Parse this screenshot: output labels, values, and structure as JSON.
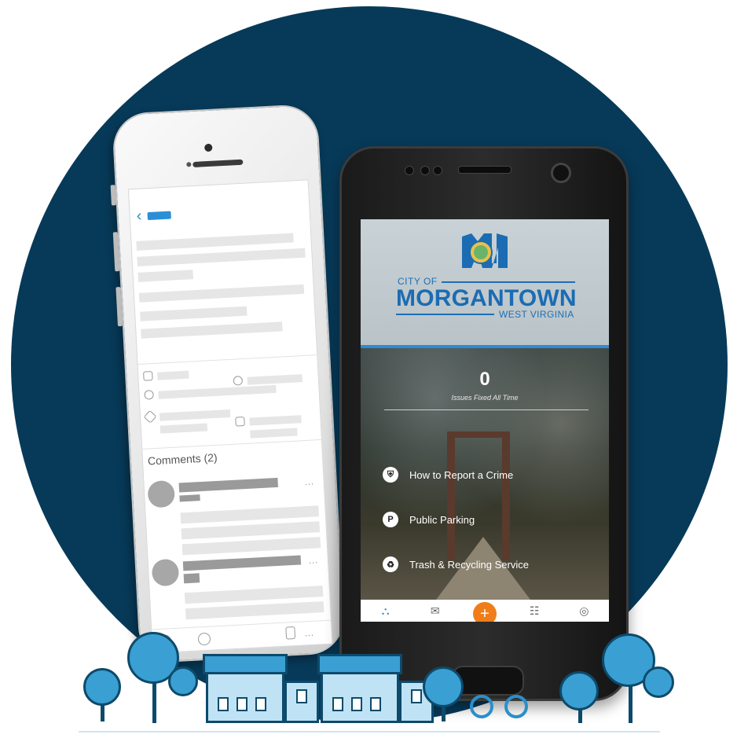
{
  "android_app": {
    "header": {
      "city_of": "CITY OF",
      "city_name": "MORGANTOWN",
      "state": "WEST VIRGINIA"
    },
    "stats": {
      "issues_fixed_count": "0",
      "issues_fixed_label": "Issues Fixed All Time"
    },
    "menu": [
      {
        "label": "How to Report a Crime",
        "icon": "shield-icon"
      },
      {
        "label": "Public Parking",
        "icon": "parking-icon"
      },
      {
        "label": "Trash & Recycling Service",
        "icon": "recycle-icon"
      }
    ],
    "tabbar": {
      "add_symbol": "+",
      "tabs": [
        "community-icon",
        "mail-icon",
        "add-icon",
        "list-icon",
        "profile-icon"
      ]
    }
  },
  "iphone_app": {
    "comments_label": "Comments (2)",
    "more_symbol": "..."
  },
  "colors": {
    "circle_bg": "#073a59",
    "brand_blue": "#1b6cb3",
    "accent_orange": "#f07d1a",
    "tree_blue": "#3a9fd3"
  }
}
